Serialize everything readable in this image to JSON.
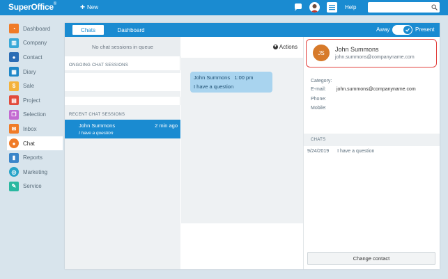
{
  "topbar": {
    "logo": "SuperOffice",
    "new_label": "New",
    "help_label": "Help",
    "search_placeholder": ""
  },
  "sidebar": {
    "items": [
      {
        "label": "Dashboard",
        "icon": "dashboard-icon",
        "color": "#f07b27"
      },
      {
        "label": "Company",
        "icon": "company-icon",
        "color": "#3aa9d8"
      },
      {
        "label": "Contact",
        "icon": "contact-icon",
        "color": "#2b6db5"
      },
      {
        "label": "Diary",
        "icon": "diary-icon",
        "color": "#1f88c8"
      },
      {
        "label": "Sale",
        "icon": "sale-icon",
        "color": "#f4b23b"
      },
      {
        "label": "Project",
        "icon": "project-icon",
        "color": "#e24b3b"
      },
      {
        "label": "Selection",
        "icon": "selection-icon",
        "color": "#c36ad1"
      },
      {
        "label": "Inbox",
        "icon": "inbox-icon",
        "color": "#f07b27"
      },
      {
        "label": "Chat",
        "icon": "chat-icon",
        "color": "#f07b27"
      },
      {
        "label": "Reports",
        "icon": "reports-icon",
        "color": "#3a85c9"
      },
      {
        "label": "Marketing",
        "icon": "marketing-icon",
        "color": "#27a3c8"
      },
      {
        "label": "Service",
        "icon": "service-icon",
        "color": "#2ab8a0"
      }
    ]
  },
  "tabs": {
    "chats": "Chats",
    "dashboard": "Dashboard",
    "away": "Away",
    "present": "Present"
  },
  "queue": {
    "empty": "No chat sessions in queue",
    "ongoing_label": "ONGOING CHAT SESSIONS",
    "recent_label": "RECENT CHAT SESSIONS"
  },
  "session": {
    "name": "John Summons",
    "ago": "2 min ago",
    "message": "I have a question"
  },
  "conversation": {
    "actions_label": "Actions",
    "bubble_name": "John Summons",
    "bubble_time": "1:00 pm",
    "bubble_text": "I have a question"
  },
  "contact": {
    "initials": "JS",
    "name": "John Summons",
    "email": "john.summons@companyname.com",
    "category_label": "Category:",
    "email_label": "E-mail:",
    "email_value": "john.summons@companyname.com",
    "phone_label": "Phone:",
    "mobile_label": "Mobile:",
    "chats_label": "CHATS",
    "chat_date": "9/24/2019",
    "chat_text": "I have a question",
    "change_button": "Change contact"
  },
  "colors": {
    "accent": "#1a8bd1",
    "highlight": "#e2403d",
    "avatar": "#d77a2a"
  }
}
